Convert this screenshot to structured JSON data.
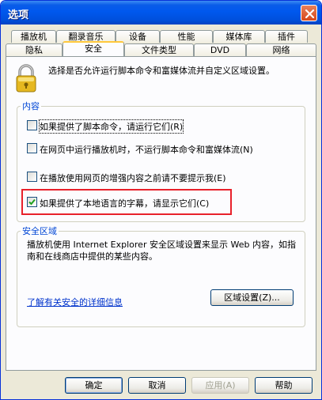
{
  "window": {
    "title": "选项"
  },
  "tabs": {
    "top_row": [
      "播放机",
      "翻录音乐",
      "设备",
      "性能",
      "媒体库",
      "插件"
    ],
    "bottom_row": [
      "隐私",
      "安全",
      "文件类型",
      "DVD",
      "网络"
    ],
    "active": "安全"
  },
  "intro": "选择是否允许运行脚本命令和富媒体流并自定义区域设置。",
  "content_group": {
    "legend": "内容",
    "options": [
      {
        "label": "如果提供了脚本命令，请运行它们(R)",
        "checked": false
      },
      {
        "label": "在网页中运行播放机时，不运行脚本命令和富媒体流(N)",
        "checked": false
      },
      {
        "label": "在播放使用网页的增强内容之前请不要提示我(E)",
        "checked": false
      },
      {
        "label": "如果提供了本地语言的字幕，请显示它们(C)",
        "checked": true
      }
    ]
  },
  "security_zone": {
    "legend": "安全区域",
    "description": "播放机使用 Internet Explorer 安全区域设置来显示 Web 内容，如指南和在线商店中提供的某些内容。",
    "link": "了解有关安全的详细信息",
    "zone_button": "区域设置(Z)..."
  },
  "buttons": {
    "ok": "确定",
    "cancel": "取消",
    "apply": "应用(A)",
    "help": "帮助"
  },
  "colors": {
    "title_bar": "#0058ee",
    "legend": "#0046d5",
    "highlight": "#e8212b",
    "active_tab_top": "#ffc83c"
  }
}
